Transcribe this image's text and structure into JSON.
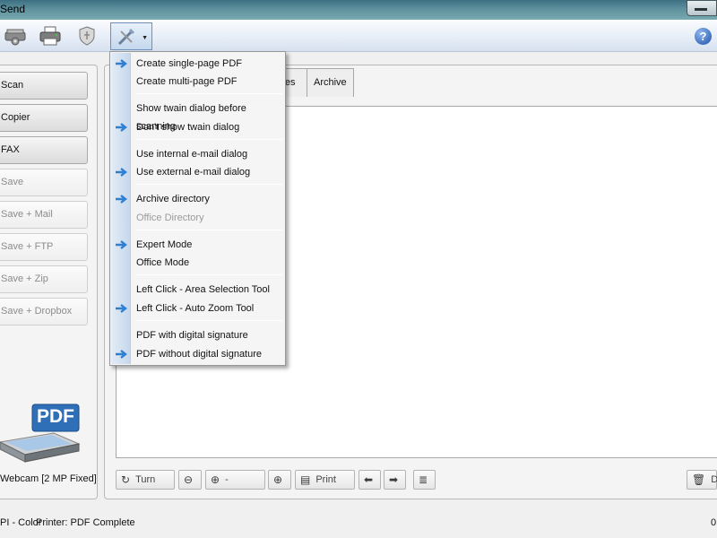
{
  "window": {
    "title": "Send"
  },
  "toolbar": {
    "buttons": [
      {
        "name": "scanner-settings-icon"
      },
      {
        "name": "printer-icon"
      },
      {
        "name": "security-icon"
      },
      {
        "name": "tools-icon"
      }
    ],
    "help_label": "?"
  },
  "sidebar": {
    "buttons": [
      {
        "label": "Scan",
        "enabled": true
      },
      {
        "label": "Copier",
        "enabled": true
      },
      {
        "label": "FAX",
        "enabled": true
      },
      {
        "label": "Save",
        "enabled": false
      },
      {
        "label": "Save + Mail",
        "enabled": false
      },
      {
        "label": "Save + FTP",
        "enabled": false
      },
      {
        "label": "Save + Zip",
        "enabled": false
      },
      {
        "label": "Save + Dropbox",
        "enabled": false
      }
    ],
    "badge": "PDF",
    "device_label": "Webcam [2 MP Fixed]"
  },
  "tabs": [
    {
      "label": "iles"
    },
    {
      "label": "Archive"
    }
  ],
  "bottom_toolbar": {
    "turn_label": "Turn",
    "zoom_label": "-",
    "print_label": "Print",
    "delete_label": "D"
  },
  "menu": {
    "items": [
      {
        "label": "Create single-page PDF",
        "checked": true,
        "enabled": true
      },
      {
        "label": "Create multi-page PDF",
        "checked": false,
        "enabled": true
      },
      {
        "label": "Show twain dialog before scanning",
        "checked": false,
        "enabled": true
      },
      {
        "label": "Don't show twain dialog",
        "checked": true,
        "enabled": true
      },
      {
        "label": "Use internal e-mail dialog",
        "checked": false,
        "enabled": true
      },
      {
        "label": "Use external e-mail dialog",
        "checked": true,
        "enabled": true
      },
      {
        "label": "Archive directory",
        "checked": true,
        "enabled": true
      },
      {
        "label": "Office Directory",
        "checked": false,
        "enabled": false
      },
      {
        "label": "Expert Mode",
        "checked": true,
        "enabled": true
      },
      {
        "label": "Office Mode",
        "checked": false,
        "enabled": true
      },
      {
        "label": "Left Click - Area Selection Tool",
        "checked": false,
        "enabled": true
      },
      {
        "label": "Left Click - Auto Zoom Tool",
        "checked": true,
        "enabled": true
      },
      {
        "label": "PDF with digital signature",
        "checked": false,
        "enabled": true
      },
      {
        "label": "PDF without digital signature",
        "checked": true,
        "enabled": true
      }
    ]
  },
  "status": {
    "left": "PI - Color",
    "printer": "Printer: PDF Complete",
    "right": "0"
  },
  "colors": {
    "accent": "#1f6bbf",
    "arrow": "#2f7fd1"
  }
}
